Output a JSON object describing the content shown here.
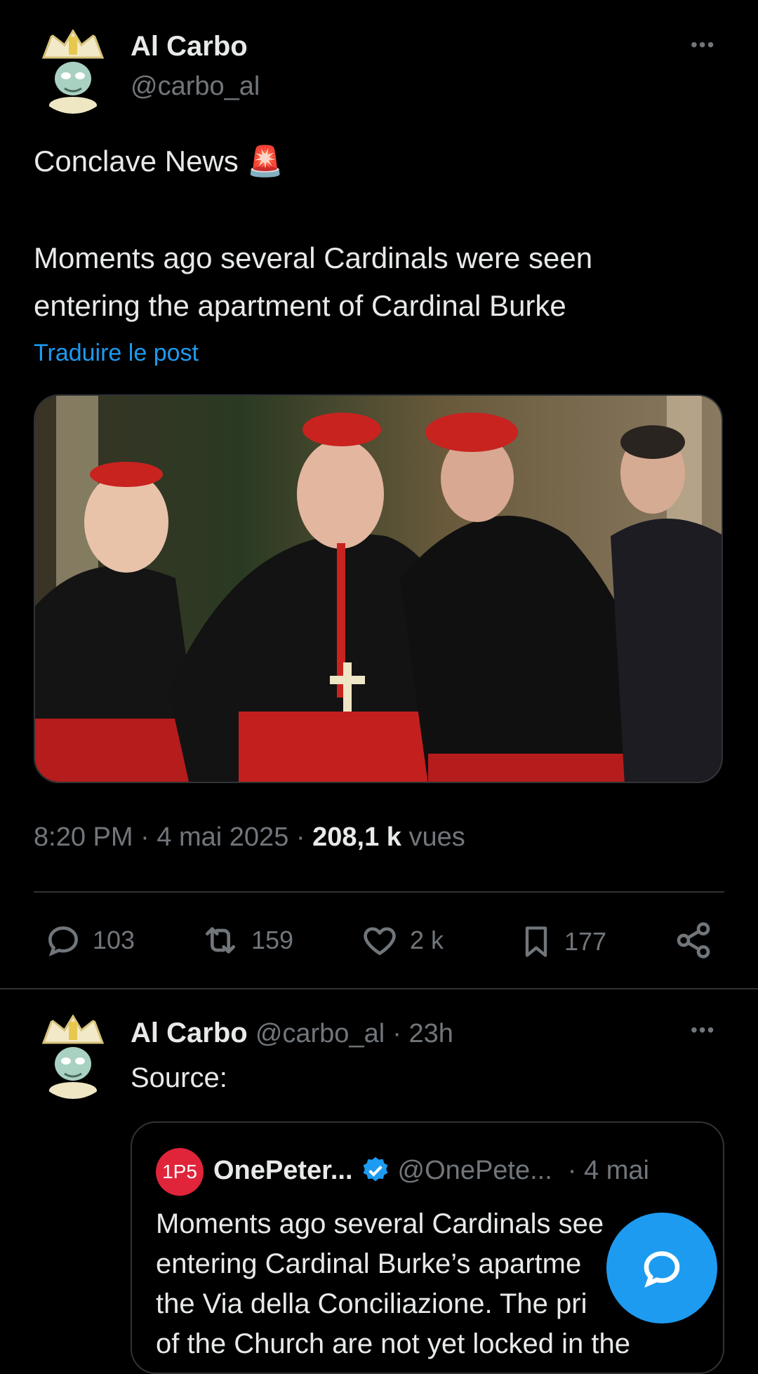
{
  "main_post": {
    "author_name": "Al Carbo",
    "author_handle": "@carbo_al",
    "more_label": "•••",
    "text_line1": "Conclave News 🚨",
    "text_line2": "Moments ago several Cardinals were seen",
    "text_line3": "entering the apartment of Cardinal Burke",
    "translate_label": "Traduire le post",
    "time": "8:20 PM",
    "sep": "·",
    "date": "4 mai 2025",
    "views_count": "208,1 k",
    "views_label": "vues",
    "actions": {
      "replies": "103",
      "reposts": "159",
      "likes": "2 k",
      "bookmarks": "177"
    }
  },
  "reply_post": {
    "author_name": "Al Carbo",
    "author_handle": "@carbo_al",
    "time": "· 23h",
    "more_label": "•••",
    "text": "Source:",
    "quoted": {
      "badge": "1P5",
      "name": "OnePeter...",
      "handle": "@OnePete...",
      "date": "· 4 mai",
      "line1": "Moments ago several Cardinals see",
      "line2": "entering Cardinal Burke’s apartme",
      "line3": "the Via della Conciliazione. The pri",
      "line4": "of the Church are not yet locked in the"
    }
  },
  "colors": {
    "background": "#000000",
    "accent": "#1d9bf0",
    "muted": "#71767b",
    "text": "#e7e9ea",
    "badge": "#e0243a"
  },
  "icons": [
    "more-icon",
    "reply-icon",
    "repost-icon",
    "like-icon",
    "bookmark-icon",
    "share-icon",
    "verified-icon",
    "compose-reply-icon"
  ]
}
